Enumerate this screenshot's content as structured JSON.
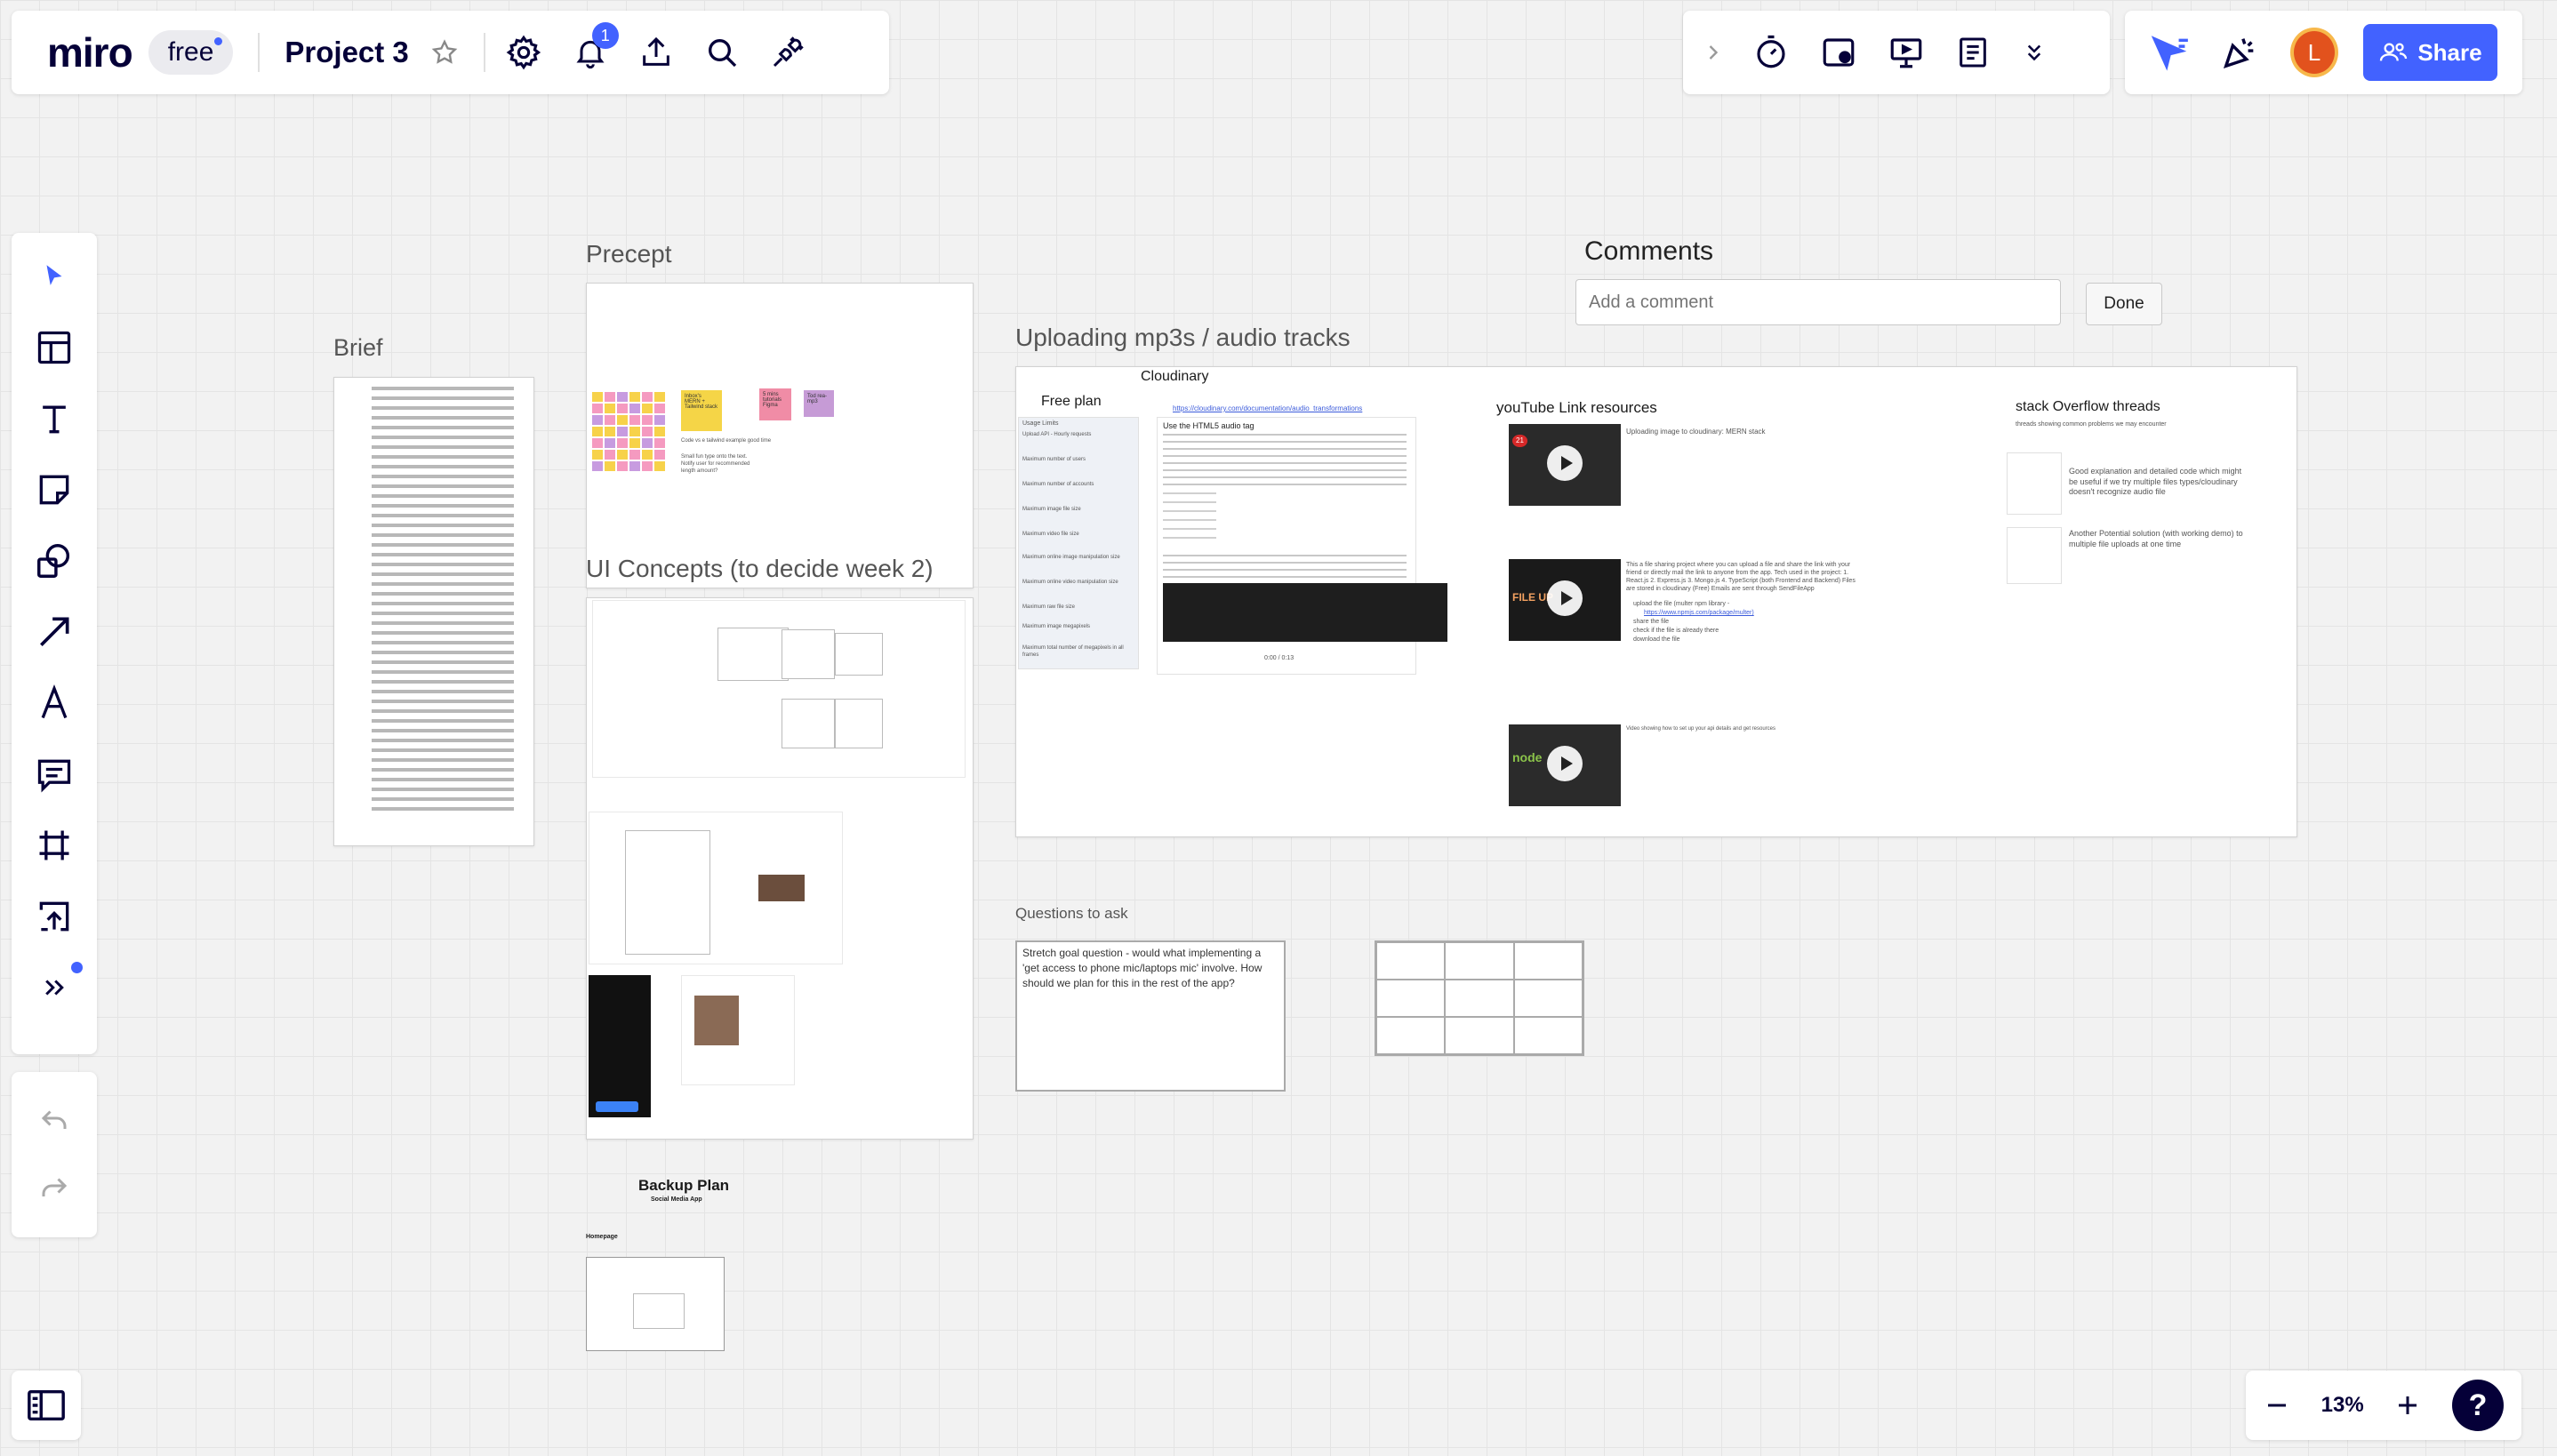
{
  "app": {
    "logo": "miro",
    "plan": "free",
    "board_title": "Project 3",
    "notification_count": "1"
  },
  "top_left_icons": [
    "star-icon",
    "settings-icon",
    "bell-icon",
    "upload-icon",
    "search-icon",
    "plug-icon"
  ],
  "top_right_tools": [
    "chevron-right-icon",
    "timer-icon",
    "voting-icon",
    "presentation-icon",
    "notes-icon",
    "chevron-double-down-icon"
  ],
  "user": {
    "avatar_initial": "L",
    "share_label": "Share"
  },
  "left_toolbar": [
    "select-icon",
    "templates-icon",
    "text-icon",
    "sticky-note-icon",
    "shapes-icon",
    "arrow-icon",
    "pen-icon",
    "comment-icon",
    "frame-icon",
    "upload-icon",
    "more-icon"
  ],
  "zoom": {
    "value": "13%"
  },
  "help_label": "?",
  "accent_color": "#4262ff",
  "canvas": {
    "brief": {
      "label": "Brief"
    },
    "precept": {
      "label": "Precept",
      "stickies": [
        {
          "text": "Inbox's MERN + Tailwind stack",
          "color": "#f5d547"
        },
        {
          "text": "5 mins tutorials Figma",
          "color": "#f08ca6"
        },
        {
          "text": "Tod rea-mp3",
          "color": "#c69bd6"
        }
      ],
      "note_line1": "Code vs e tailwind example good time",
      "note_line2": "Small fun type onto the text. Notify user for recommended length amount?"
    },
    "ui_concepts": {
      "label": "UI Concepts (to decide week 2)"
    },
    "backup": {
      "title": "Backup Plan",
      "subtitle": "Social Media App",
      "homepage": "Homepage"
    },
    "comments": {
      "heading": "Comments",
      "placeholder": "Add a comment",
      "done_label": "Done"
    },
    "uploading": {
      "label": "Uploading mp3s / audio tracks",
      "cloudinary": "Cloudinary",
      "free_plan": "Free plan",
      "cloudinary_link": "https://cloudinary.com/documentation/audio_transformations",
      "doc_heading": "Use the HTML5 audio tag",
      "audio_time": "0:00 / 0:13",
      "usage_heading": "Usage Limits",
      "usage_rows": [
        "Upload API - Hourly requests",
        "Maximum number of users",
        "Maximum number of accounts",
        "Maximum image file size",
        "Maximum video file size",
        "Maximum online image manipulation size",
        "Maximum online video manipulation size",
        "Maximum raw file size",
        "Maximum image megapixels",
        "Maximum total number of megapixels in all frames"
      ],
      "youtube_heading": "youTube Link resources",
      "videos": [
        {
          "caption": "Uploading image to cloudinary: MERN stack",
          "thumb_text": "21"
        },
        {
          "caption": "This a file sharing project where you can upload a file and share the link with your friend or directly mail the link to anyone from the app. Tech used in the project: 1. React.js 2. Express.js 3. Mongo.js 4. TypeScript (both Frontend and Backend) Files are stored in cloudinary (Free) Emails are sent through SendFileApp",
          "thumb_text": "FILE UP"
        },
        {
          "caption": "Video showing how to set up your api details and get resources",
          "thumb_text": "node"
        }
      ],
      "video2_steps": [
        "upload the file (multer npm library -",
        "https://www.npmjs.com/package/multer)",
        "share the file",
        "check if the file is already there",
        "download the file"
      ],
      "stackoverflow_heading": "stack Overflow threads",
      "stackoverflow_sub": "threads showing common problems we may encounter",
      "threads": [
        {
          "text": "Good explanation and detailed code which might be useful if we try multiple files types/cloudinary doesn't recognize audio file"
        },
        {
          "text": "Another Potential solution (with working demo) to multiple file uploads at one time"
        }
      ]
    },
    "questions": {
      "label": "Questions to ask",
      "text": "Stretch goal question - would what implementing a 'get access to phone mic/laptops mic' involve. How should we plan for this in the rest of the app?"
    }
  }
}
